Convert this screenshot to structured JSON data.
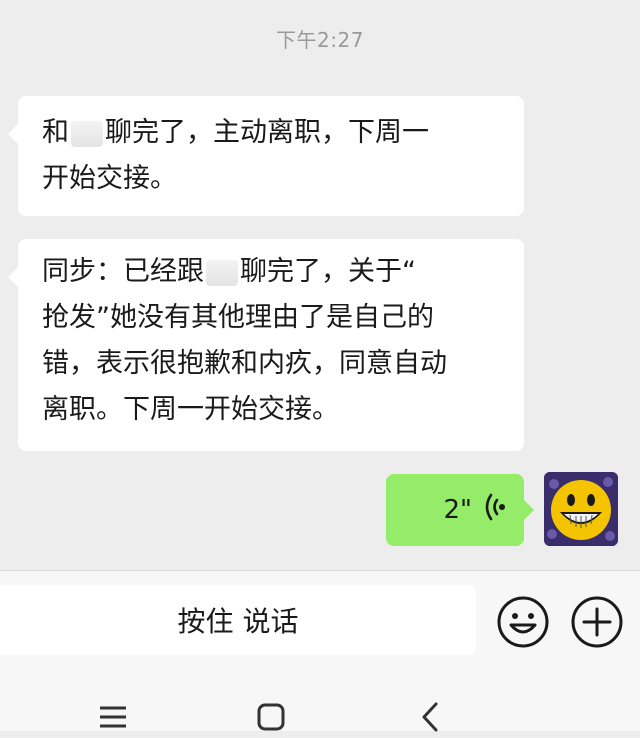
{
  "timestamp": "下午2:27",
  "messages": [
    {
      "lines": [
        {
          "before": "和",
          "after": "聊完了，主动离职，下周一"
        },
        {
          "text": "开始交接。"
        }
      ]
    },
    {
      "lines": [
        {
          "before": "同步：已经跟",
          "after": "聊完了，关于“"
        },
        {
          "text": "抢发”她没有其他理由了是自己的"
        },
        {
          "text": "错，表示很抱歉和内疚，同意自动"
        },
        {
          "text": "离职。下周一开始交接。"
        }
      ]
    }
  ],
  "voice_message": {
    "duration": "2\"",
    "bubble_color": "#95ec69"
  },
  "input_bar": {
    "hold_to_talk": "按住 说话"
  },
  "icons": {
    "emoji": "smiley-face-icon",
    "add": "plus-circle-icon",
    "nav_menu": "menu-icon",
    "nav_home": "home-square-icon",
    "nav_back": "back-chevron-icon"
  }
}
